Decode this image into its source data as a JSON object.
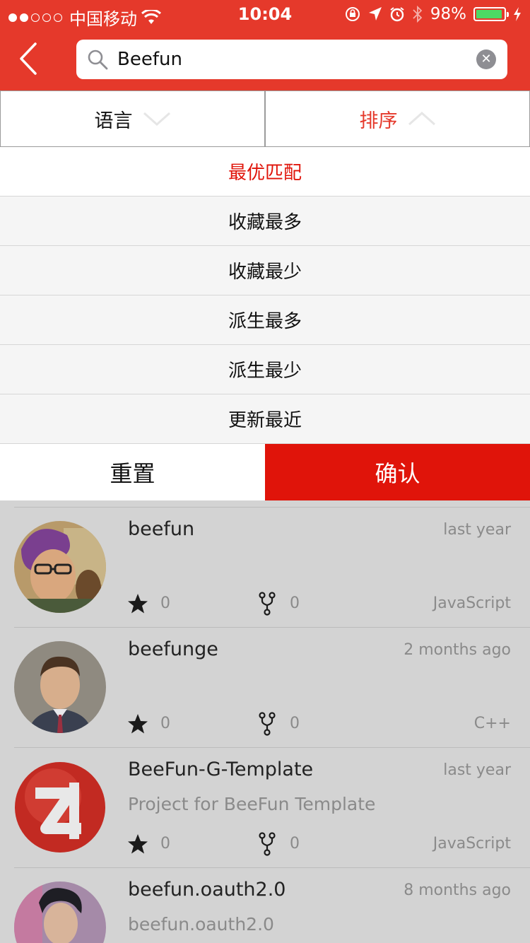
{
  "status_bar": {
    "carrier": "中国移动",
    "time": "10:04",
    "battery": "98%",
    "battery_level": 0.98,
    "icons": [
      "signal-icon",
      "wifi-icon",
      "rotation-lock-icon",
      "location-icon",
      "alarm-icon",
      "bluetooth-icon",
      "battery-icon",
      "charging-icon"
    ]
  },
  "nav": {
    "back_icon": "chevron-left-icon",
    "search": {
      "value": "Beefun",
      "icon": "search-icon",
      "clear_icon": "clear-icon"
    }
  },
  "tabs": [
    {
      "label": "语言",
      "icon": "chevron-down-icon",
      "active": false
    },
    {
      "label": "排序",
      "icon": "chevron-up-icon",
      "active": true
    }
  ],
  "sort_options": [
    {
      "label": "最优匹配",
      "selected": true
    },
    {
      "label": "收藏最多",
      "selected": false
    },
    {
      "label": "收藏最少",
      "selected": false
    },
    {
      "label": "派生最多",
      "selected": false
    },
    {
      "label": "派生最少",
      "selected": false
    },
    {
      "label": "更新最近",
      "selected": false
    }
  ],
  "actions": {
    "reset": "重置",
    "confirm": "确认"
  },
  "results": [
    {
      "name": "beefun",
      "time": "last year",
      "description": "",
      "stars": "0",
      "forks": "0",
      "language": "JavaScript"
    },
    {
      "name": "beefunge",
      "time": "2 months ago",
      "description": "",
      "stars": "0",
      "forks": "0",
      "language": "C++"
    },
    {
      "name": "BeeFun-G-Template",
      "time": "last year",
      "description": "Project for BeeFun Template",
      "stars": "0",
      "forks": "0",
      "language": "JavaScript"
    },
    {
      "name": "beefun.oauth2.0",
      "time": "8 months ago",
      "description": "beefun.oauth2.0",
      "stars": "",
      "forks": "",
      "language": ""
    }
  ],
  "colors": {
    "brand": "#e5392b",
    "accent": "#e0140a",
    "overlay": "#d3d3d3"
  }
}
